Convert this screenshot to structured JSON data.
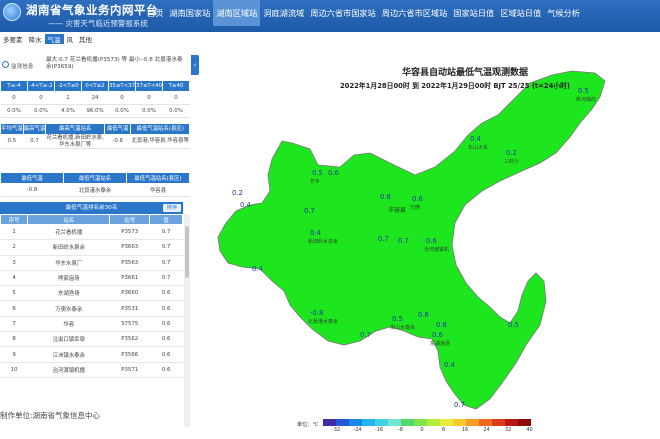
{
  "header": {
    "title": "湖南省气象业务内网平台",
    "subtitle": "—— 灾害天气临近预警报系统",
    "nav": [
      "首页",
      "湖南国家站",
      "湖南区域站",
      "洞庭湖流域",
      "周边六省市国家站",
      "周边六省市区域站",
      "国家站日值",
      "区域站日值",
      "气候分析"
    ],
    "active_nav": "湖南区域站"
  },
  "toolbar": {
    "items": [
      "多要素",
      "降水",
      "气温",
      "风",
      "其他"
    ],
    "active": "气温"
  },
  "sidebar": {
    "monitor_label": "监测信息",
    "summary": "最大:0.7 花兰看机播(P3573) 等 最小:-0.8 北景港水泰余(P3659)",
    "range_table": {
      "headers": [
        "T≤-4",
        "-4<T≤-2",
        "-2<T≤0",
        "0<T≤2",
        "35≤T<37",
        "37≤T<40",
        "T≥40"
      ],
      "counts": [
        "0",
        "0",
        "1",
        "24",
        "0",
        "0",
        "0"
      ],
      "percents": [
        "0.0%",
        "0.0%",
        "4.0%",
        "96.0%",
        "0.0%",
        "0.0%",
        "0.0%"
      ]
    },
    "stats_table": {
      "headers": [
        "平均气温",
        "最高气温",
        "最高气温站名",
        "最低气温",
        "最低气温站名(县区)"
      ],
      "row": [
        "0.5",
        "0.7",
        "花兰看机播,新田岭水泉,华东水泉厂等",
        "-0.8",
        "北景港,华容县,华容县等"
      ]
    },
    "min_table": {
      "headers": [
        "最低气温",
        "最低气温站名",
        "最低气温站名(县区)"
      ],
      "row": [
        "-0.8",
        "北景港水泰余",
        "华容县"
      ]
    },
    "rank_title": "最低气温排名前30名",
    "sort_label": "排序",
    "rank_headers": [
      "序号",
      "站名",
      "站号",
      "值"
    ],
    "rank_rows": [
      [
        "1",
        "花兰看机播",
        "P3573",
        "0.7"
      ],
      [
        "2",
        "新田岭水泉余",
        "P3663",
        "0.7"
      ],
      [
        "3",
        "华东水泉厂",
        "P3563",
        "0.7"
      ],
      [
        "4",
        "熊家庙场",
        "P3661",
        "0.7"
      ],
      [
        "5",
        "东湖渔场",
        "P3660",
        "0.6"
      ],
      [
        "6",
        "万庚水泰余",
        "P3531",
        "0.6"
      ],
      [
        "7",
        "华容",
        "57575",
        "0.6"
      ],
      [
        "8",
        "注滋口镇幸墩",
        "P3562",
        "0.6"
      ],
      [
        "9",
        "江洲镇水泰余",
        "P3566",
        "0.6"
      ],
      [
        "10",
        "治河渡镇机播",
        "P3571",
        "0.6"
      ]
    ]
  },
  "footer": "制作单位:湖南省气象信息中心",
  "map": {
    "title": "华容县自动站最低气温观测数据",
    "subtitle": "2022年1月28日00时 到 2022年1月29日00时 BJT 25/25 (t=24小时)",
    "fill_color": "#1ee61e",
    "border_color": "#777777",
    "county_label": "华容县",
    "labels": [
      {
        "value": "0.5",
        "name": "新河镇的"
      },
      {
        "value": "0.4",
        "name": "东山大东"
      },
      {
        "value": "0.2",
        "name": "三封小"
      },
      {
        "value": "0.5",
        "name": "芒乡"
      },
      {
        "value": "0.6",
        "name": ""
      },
      {
        "value": "0.2",
        "name": ""
      },
      {
        "value": "0.4",
        "name": ""
      },
      {
        "value": "0.7",
        "name": ""
      },
      {
        "value": "0.6",
        "name": ""
      },
      {
        "value": "0.6",
        "name": "万庚"
      },
      {
        "value": "0.7",
        "name": ""
      },
      {
        "value": "0.4",
        "name": "新田岭水泉余"
      },
      {
        "value": "0.7",
        "name": ""
      },
      {
        "value": "0.6",
        "name": "治河渡镇机"
      },
      {
        "value": "0.4",
        "name": ""
      },
      {
        "value": "0.6",
        "name": ""
      },
      {
        "value": "-0.8",
        "name": "北景港水泰余"
      },
      {
        "value": "0.7",
        "name": ""
      },
      {
        "value": "0.5",
        "name": "南山水泰余"
      },
      {
        "value": "0.6",
        "name": ""
      },
      {
        "value": "0.6",
        "name": "东湖渔场"
      },
      {
        "value": "0.5",
        "name": ""
      },
      {
        "value": "0.4",
        "name": ""
      },
      {
        "value": "0.7",
        "name": ""
      }
    ]
  },
  "legend": {
    "label": "单位：℃",
    "ticks": [
      "-32",
      "-24",
      "-16",
      "-8",
      "0",
      "8",
      "16",
      "24",
      "32",
      "40"
    ],
    "colors": [
      "#3d2ca8",
      "#2456d6",
      "#1a86e8",
      "#20b6ee",
      "#3fd2e6",
      "#6fe6d0",
      "#52d96b",
      "#7fe34a",
      "#b6ec3a",
      "#e8ef3a",
      "#f5c92e",
      "#f59b26",
      "#ee6a22",
      "#dc3a1c",
      "#b81515",
      "#8e0a0a"
    ]
  }
}
